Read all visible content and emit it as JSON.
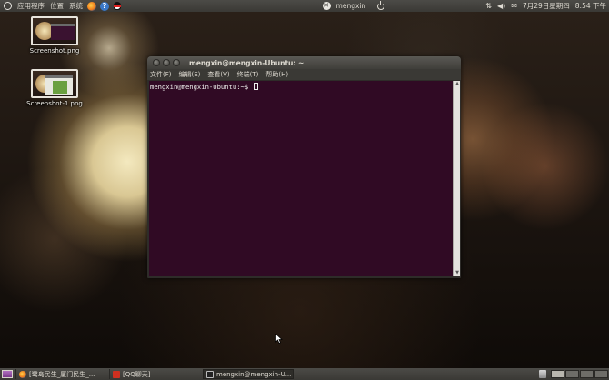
{
  "top_panel": {
    "menus": [
      "应用程序",
      "位置",
      "系统"
    ],
    "user": "mengxin",
    "datetime": "7月29日星期四",
    "time": "8:54 下午"
  },
  "desktop": {
    "icons": [
      {
        "label": "Screenshot.png"
      },
      {
        "label": "Screenshot-1.png"
      }
    ]
  },
  "terminal": {
    "title": "mengxin@mengxin-Ubuntu: ~",
    "menus": [
      "文件(F)",
      "编辑(E)",
      "查看(V)",
      "终端(T)",
      "帮助(H)"
    ],
    "prompt": "mengxin@mengxin-Ubuntu:~$"
  },
  "bottom_panel": {
    "tasks": [
      {
        "label": "[鹭岛民生_厦门民生_..."
      },
      {
        "label": "[QQ聊天]"
      },
      {
        "label": "mengxin@mengxin-U..."
      }
    ]
  },
  "colors": {
    "panel": "#3a3935",
    "terminal_bg": "#300a24",
    "terminal_text": "#eeeeec"
  }
}
